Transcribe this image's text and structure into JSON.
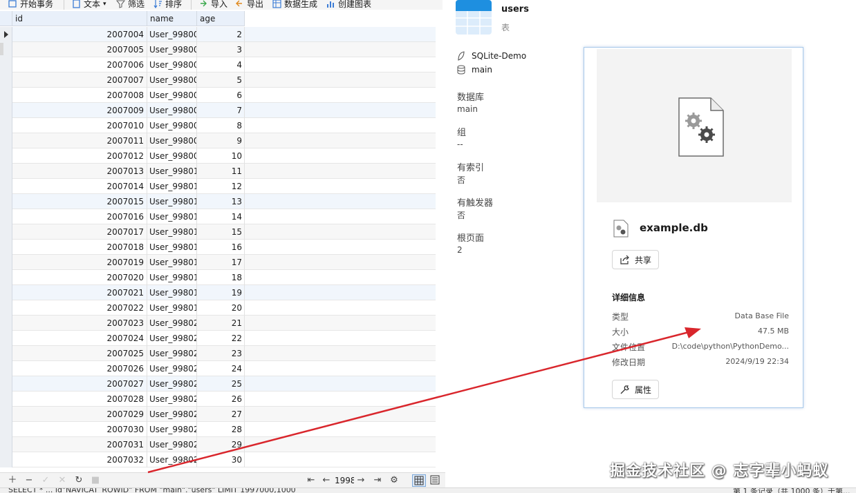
{
  "toolbar": {
    "begin_transaction": "开始事务",
    "text": "文本",
    "filter": "筛选",
    "sort": "排序",
    "import": "导入",
    "export": "导出",
    "data_generate": "数据生成",
    "create_chart": "创建图表"
  },
  "grid": {
    "columns": [
      "id",
      "name",
      "age"
    ],
    "rows": [
      {
        "id": "2007004",
        "name": "User_99800",
        "age": "2"
      },
      {
        "id": "2007005",
        "name": "User_99800",
        "age": "3"
      },
      {
        "id": "2007006",
        "name": "User_99800",
        "age": "4"
      },
      {
        "id": "2007007",
        "name": "User_99800",
        "age": "5"
      },
      {
        "id": "2007008",
        "name": "User_99800",
        "age": "6"
      },
      {
        "id": "2007009",
        "name": "User_99800",
        "age": "7"
      },
      {
        "id": "2007010",
        "name": "User_99800",
        "age": "8"
      },
      {
        "id": "2007011",
        "name": "User_99800",
        "age": "9"
      },
      {
        "id": "2007012",
        "name": "User_99800",
        "age": "10"
      },
      {
        "id": "2007013",
        "name": "User_99801",
        "age": "11"
      },
      {
        "id": "2007014",
        "name": "User_99801",
        "age": "12"
      },
      {
        "id": "2007015",
        "name": "User_99801",
        "age": "13"
      },
      {
        "id": "2007016",
        "name": "User_99801",
        "age": "14"
      },
      {
        "id": "2007017",
        "name": "User_99801",
        "age": "15"
      },
      {
        "id": "2007018",
        "name": "User_99801",
        "age": "16"
      },
      {
        "id": "2007019",
        "name": "User_99801",
        "age": "17"
      },
      {
        "id": "2007020",
        "name": "User_99801",
        "age": "18"
      },
      {
        "id": "2007021",
        "name": "User_99801",
        "age": "19"
      },
      {
        "id": "2007022",
        "name": "User_99801",
        "age": "20"
      },
      {
        "id": "2007023",
        "name": "User_99802",
        "age": "21"
      },
      {
        "id": "2007024",
        "name": "User_99802",
        "age": "22"
      },
      {
        "id": "2007025",
        "name": "User_99802",
        "age": "23"
      },
      {
        "id": "2007026",
        "name": "User_99802",
        "age": "24"
      },
      {
        "id": "2007027",
        "name": "User_99802",
        "age": "25"
      },
      {
        "id": "2007028",
        "name": "User_99802",
        "age": "26"
      },
      {
        "id": "2007029",
        "name": "User_99802",
        "age": "27"
      },
      {
        "id": "2007030",
        "name": "User_99802",
        "age": "28"
      },
      {
        "id": "2007031",
        "name": "User_99802",
        "age": "29"
      },
      {
        "id": "2007032",
        "name": "User_99802",
        "age": "30"
      }
    ]
  },
  "bottombar": {
    "page_value": "1998"
  },
  "statusbar": {
    "sql": "SELECT * ... id\"NAVICAT_ROWID\" FROM \"main\".\"users\" LIMIT 1997000,1000",
    "record_info": "第 1 条记录（共 1000 条）于第..."
  },
  "info": {
    "table_name": "users",
    "table_kind": "表",
    "connection": "SQLite-Demo",
    "schema": "main",
    "properties": [
      {
        "label": "数据库",
        "value": "main"
      },
      {
        "label": "组",
        "value": "--"
      },
      {
        "label": "有索引",
        "value": "否"
      },
      {
        "label": "有触发器",
        "value": "否"
      },
      {
        "label": "根页面",
        "value": "2"
      }
    ]
  },
  "file_panel": {
    "file_name": "example.db",
    "share_label": "共享",
    "details_title": "详细信息",
    "details": [
      {
        "label": "类型",
        "value": "Data Base File"
      },
      {
        "label": "大小",
        "value": "47.5 MB"
      },
      {
        "label": "文件位置",
        "value": "D:\\code\\python\\PythonDemo..."
      },
      {
        "label": "修改日期",
        "value": "2024/9/19 22:34"
      }
    ],
    "properties_label": "属性"
  },
  "colors": {
    "accent_blue": "#1e8fe0",
    "arrow_red": "#d9262c",
    "header_bg": "#e9f0fa"
  },
  "watermark": "掘金技术社区 @ 志字辈小蚂蚁"
}
